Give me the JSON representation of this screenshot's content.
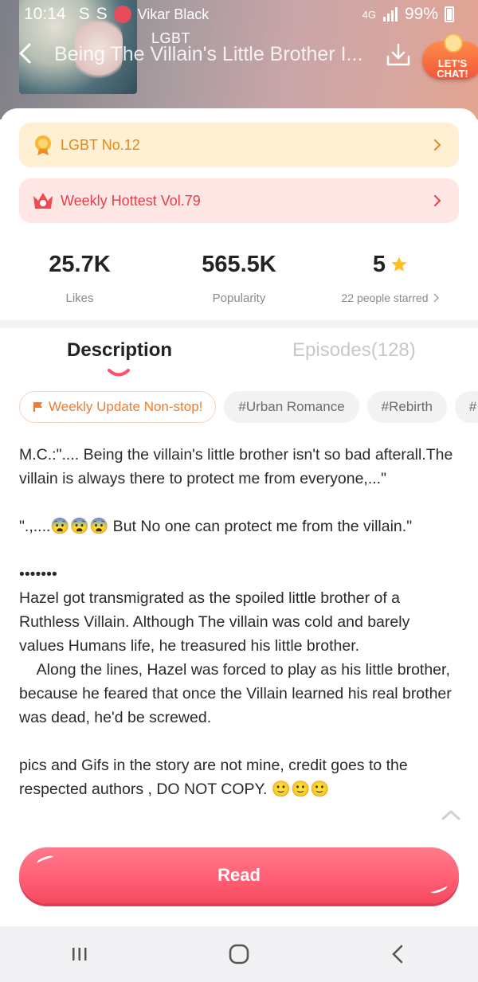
{
  "status_bar": {
    "time": "10:14",
    "left_icons": [
      "S",
      "S"
    ],
    "username": "Vikar Black",
    "battery": "99%",
    "network": "4G"
  },
  "header": {
    "genre": "LGBT",
    "title": "Being The Villain's Little Brother I...",
    "chat_badge": "LET'S CHAT!"
  },
  "rankings": [
    {
      "label": "LGBT No.12",
      "color": "#e08a1c",
      "icon": "medal-icon"
    },
    {
      "label": "Weekly Hottest Vol.79",
      "color": "#e6404a",
      "icon": "crown-icon"
    }
  ],
  "stats": {
    "likes_value": "25.7K",
    "likes_label": "Likes",
    "popularity_value": "565.5K",
    "popularity_label": "Popularity",
    "rating_value": "5",
    "rating_label": "22 people starred"
  },
  "tabs": {
    "description": "Description",
    "episodes": "Episodes(128)"
  },
  "tags": [
    "Weekly Update Non-stop!",
    "#Urban Romance",
    "#Rebirth",
    "#"
  ],
  "description": {
    "p1": "M.C.:\".... Being the villain's little brother isn't so bad afterall.The villain is always there to protect me from everyone,...\"",
    "p2": "\".,....😨😨😨 But No one can protect me from the villain.\"",
    "p3": "•••••••",
    "p4": "Hazel got transmigrated as the spoiled little brother of a Ruthless Villain. Although The villain was cold and barely values Humans life, he treasured his little brother.\n    Along the lines, Hazel was forced to play as his little brother, because he feared that once the Villain learned his real brother was dead, he'd be screwed.",
    "p5": "pics and Gifs in the story are not mine, credit goes to the respected authors , DO NOT COPY. 🙂🙂🙂"
  },
  "read_button": "Read",
  "colors": {
    "accent": "#ff5d73",
    "rank_orange": "#e08a1c",
    "rank_red": "#e6404a",
    "tag_orange": "#ef7c2e"
  }
}
